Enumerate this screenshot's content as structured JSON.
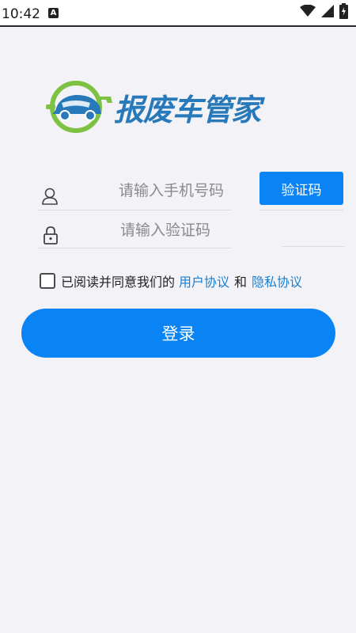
{
  "status_bar": {
    "time": "10:42",
    "notification_badge": "A",
    "icons": [
      "wifi-icon",
      "signal-icon",
      "battery-icon"
    ]
  },
  "logo": {
    "text": "报废车管家",
    "icon": "car-wrench-logo-icon"
  },
  "phone_field": {
    "placeholder": "请输入手机号码",
    "icon": "user-icon"
  },
  "code_field": {
    "placeholder": "请输入验证码",
    "icon": "lock-icon"
  },
  "send_code_button": {
    "label": "验证码"
  },
  "agreement": {
    "prefix": "已阅读并同意我们的",
    "user_agreement": "用户协议",
    "conjunction": "和",
    "privacy_policy": "隐私协议",
    "checked": false
  },
  "login_button": {
    "label": "登录"
  },
  "colors": {
    "accent": "#0a84f4",
    "link": "#1a7fd0",
    "logo_text": "#2779b9",
    "logo_green": "#7dc242",
    "background": "#f3f3f7"
  }
}
